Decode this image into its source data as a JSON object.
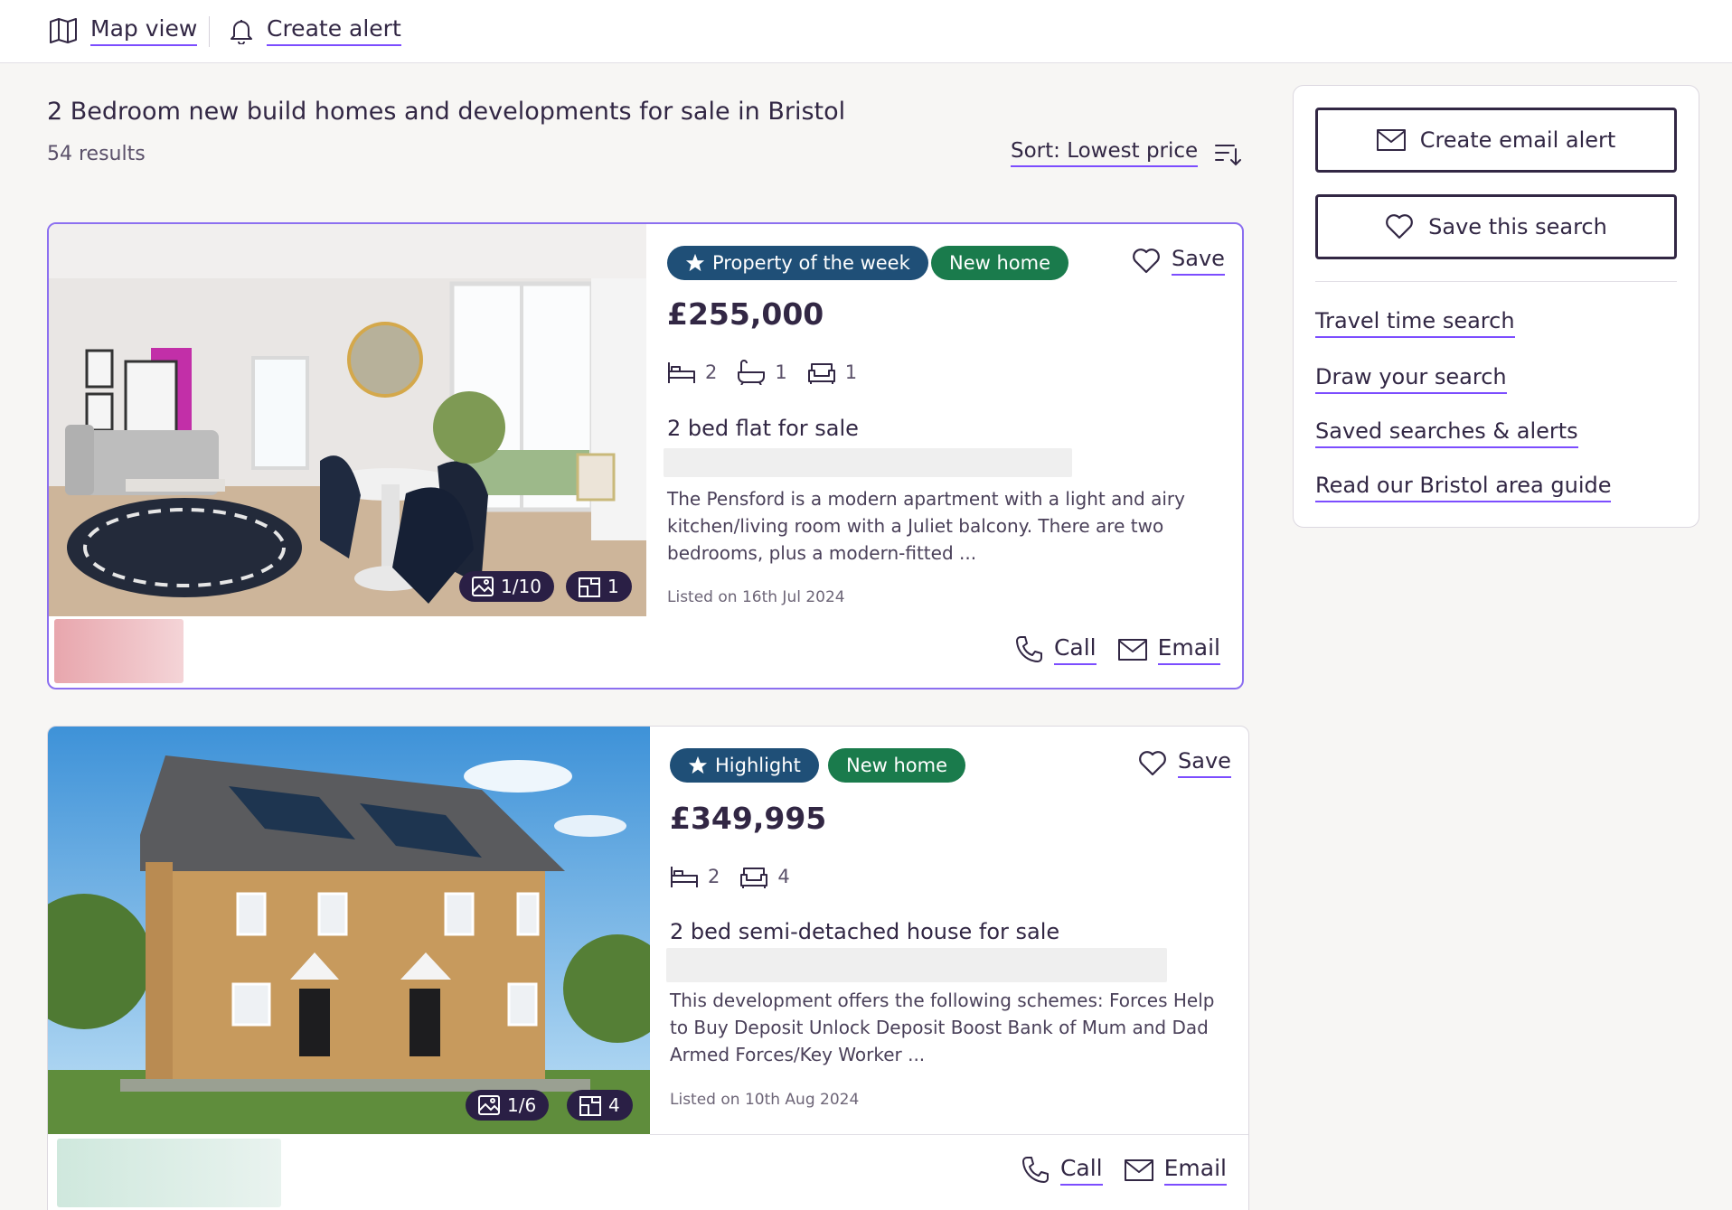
{
  "topbar": {
    "map_view": "Map view",
    "create_alert": "Create alert"
  },
  "search": {
    "title": "2 Bedroom new build homes and developments for sale in Bristol",
    "results": "54 results",
    "sort_label": "Sort: Lowest price"
  },
  "listings": [
    {
      "badge_primary": "Property of the week",
      "badge_secondary": "New home",
      "save_label": "Save",
      "price": "£255,000",
      "beds": "2",
      "baths": "1",
      "receptions": "1",
      "title": "2 bed flat for sale",
      "description": "The Pensford is a modern apartment with a light and airy kitchen/living room with a Juliet balcony. There are two bedrooms, plus a modern-fitted ...",
      "listed": "Listed on 16th Jul 2024",
      "photo_count": "1/10",
      "floorplan_count": "1",
      "call_label": "Call",
      "email_label": "Email"
    },
    {
      "badge_primary": "Highlight",
      "badge_secondary": "New home",
      "save_label": "Save",
      "price": "£349,995",
      "beds": "2",
      "receptions": "4",
      "title": "2 bed semi-detached house for sale",
      "description": "This development offers the following schemes: Forces Help to Buy Deposit Unlock Deposit Boost Bank of Mum and Dad Armed Forces/Key Worker ...",
      "listed": "Listed on 10th Aug 2024",
      "photo_count": "1/6",
      "floorplan_count": "4",
      "call_label": "Call",
      "email_label": "Email"
    }
  ],
  "sidebar": {
    "create_email_alert": "Create email alert",
    "save_search": "Save this search",
    "links": [
      "Travel time search",
      "Draw your search",
      "Saved searches & alerts",
      "Read our Bristol area guide"
    ]
  },
  "colors": {
    "accent": "#7c4dff",
    "text": "#322744",
    "badge_blue": "#1f4f77",
    "badge_green": "#1a7b4c",
    "pill_dark": "#2a1f45"
  },
  "icons": [
    "map-icon",
    "bell-icon",
    "sort-icon",
    "star-icon",
    "heart-icon",
    "bed-icon",
    "bath-icon",
    "sofa-icon",
    "phone-icon",
    "mail-icon",
    "image-icon",
    "floorplan-icon"
  ]
}
